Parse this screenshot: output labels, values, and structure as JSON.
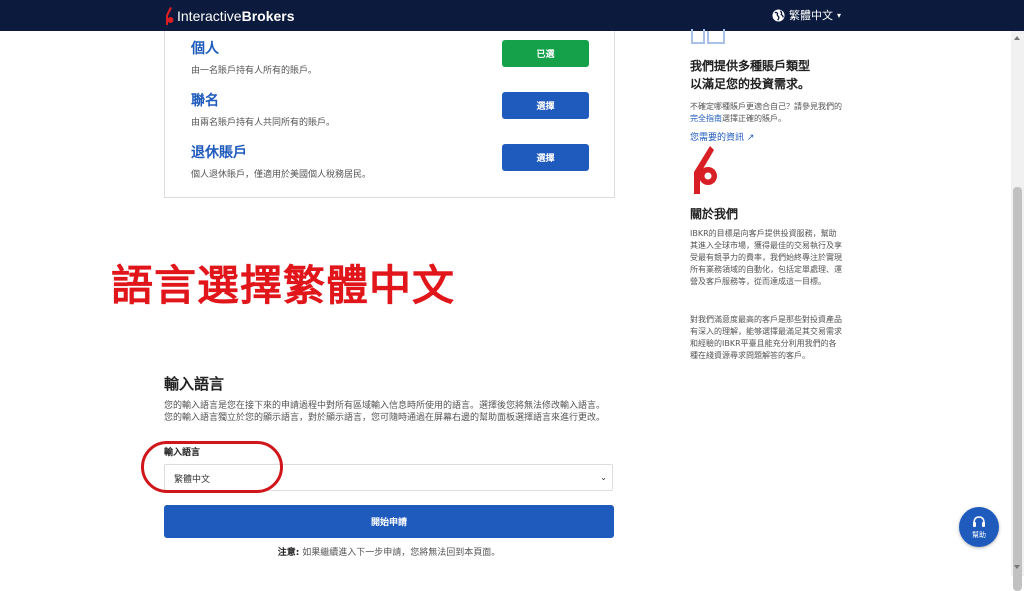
{
  "header": {
    "logo_text_a": "Interactive",
    "logo_text_b": "Brokers",
    "language": "繁體中文",
    "language_icon": "globe-icon"
  },
  "account_types": [
    {
      "title": "個人",
      "desc": "由一名賬戶持有人所有的賬戶。",
      "button": "已選",
      "selected": true
    },
    {
      "title": "聯名",
      "desc": "由兩名賬戶持有人共同所有的賬戶。",
      "button": "選擇",
      "selected": false
    },
    {
      "title": "退休賬戶",
      "desc": "個人退休賬戶，僅適用於美國個人稅務居民。",
      "button": "選擇",
      "selected": false
    }
  ],
  "sidebar": {
    "offer_heading_1": "我們提供多種賬戶類型",
    "offer_heading_2": "以滿足您的投資需求。",
    "offer_text_1": "不確定哪種賬戶更適合自己？請參見我們的",
    "offer_link": "完全指南",
    "offer_text_2": "選擇正確的賬戶。",
    "resource_link": "您需要的資訊",
    "about_heading": "關於我們",
    "about_p1": "IBKR的目標是向客戶提供投資服務，幫助其進入全球市場，獲得最佳的交易執行及享受最有競爭力的費率，我們始終專注於實現所有業務領域的自動化，包括定單處理、運營及客戶服務等，從而達成這一目標。",
    "about_p2": "對我們滿意度最高的客戶是那些對投資產品有深入的理解，能够選擇最滿足其交易需求和經驗的IBKR平臺且能充分利用我們的各種在綫資源尋求問題解答的客戶。"
  },
  "overlay_caption": "語言選擇繁體中文",
  "input_language": {
    "title": "輸入語言",
    "description": "您的輸入語言是您在接下來的申請過程中對所有區域輸入信息時所使用的語言。選擇後您將無法修改輸入語言。您的輸入語言獨立於您的顯示語言，對於顯示語言，您可隨時通過在屏幕右邊的幫助面板選擇語言來進行更改。",
    "field_label": "輸入語言",
    "selected_value": "繁體中文",
    "start_button": "開始申請",
    "note_label": "注意:",
    "note_text": " 如果繼續進入下一步申請，您將無法回到本頁面。"
  },
  "help": {
    "label": "幫助"
  },
  "colors": {
    "navbar": "#0b1a3d",
    "brand_blue": "#1f5bbd",
    "selected_green": "#14a14a",
    "annotation_red": "#e0161b"
  }
}
